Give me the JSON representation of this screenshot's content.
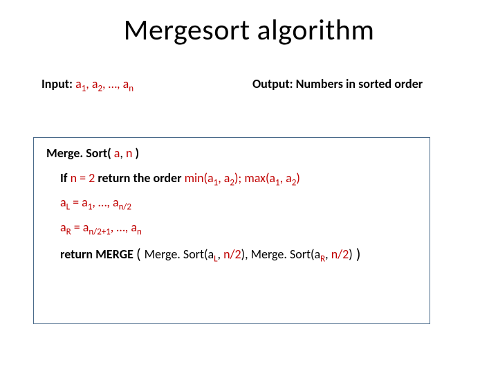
{
  "title": "Mergesort algorithm",
  "io": {
    "input_label": "Input: ",
    "input_a": "a",
    "input_expr_plain": ", …, ",
    "output_label": "Output: Numbers in sorted order",
    "sub1": "1",
    "sub2": "2",
    "subn": "n",
    "comma": ", "
  },
  "code": {
    "fn_name": "Merge. Sort(",
    "fn_arg_a": " a",
    "fn_comma": ", ",
    "fn_arg_n": "n ",
    "fn_close": ")",
    "if_lead": "If ",
    "if_cond": "n = 2",
    "if_mid": " return the order ",
    "min_lbl": "min(a",
    "min_mid": ", a",
    "min_close": ");",
    "max_lbl": " max(a",
    "max_mid": ", a",
    "max_close": ")",
    "al_lhs_a": "a",
    "al_lhs_sub": "L",
    "al_eq": " = a",
    "al_sub1": "1",
    "al_mid": ", …, a",
    "al_subn2": "n/2",
    "ar_lhs_a": "a",
    "ar_lhs_sub": "R",
    "ar_eq": " = a",
    "ar_sub1": "n/2+1",
    "ar_mid": ", …, a",
    "ar_subn": "n",
    "ret_lead": "return MERGE ",
    "ret_open": "( ",
    "ms1": "Merge. Sort(a",
    "msL": "L",
    "ms_comma": ", ",
    "n2": "n/2",
    "ms_close": ")",
    "mid_comma": ", ",
    "ms2": "Merge. Sort(a",
    "msR": "R",
    "ret_close": " )"
  }
}
